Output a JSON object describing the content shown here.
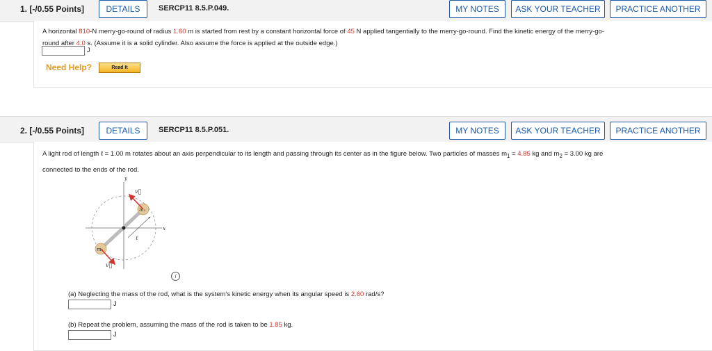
{
  "q1": {
    "number": "1.  [-/0.55 Points]",
    "details": "DETAILS",
    "code": "SERCP11 8.5.P.049.",
    "my_notes": "MY NOTES",
    "ask_teacher": "ASK YOUR TEACHER",
    "practice": "PRACTICE ANOTHER",
    "text1_a": "A horizontal ",
    "mass": "810",
    "text1_b": "-N merry-go-round of radius ",
    "radius": "1.60",
    "text1_c": " m is started from rest by a constant horizontal force of ",
    "force": "45",
    "text1_d": " N applied tangentially to the merry-go-round. Find the kinetic energy of the merry-go-",
    "text2_a": "round after ",
    "time": "4.0",
    "text2_b": " s. (Assume it is a solid cylinder. Also assume the force is applied at the outside edge.)",
    "unit": "J",
    "need_help": "Need Help?",
    "read_it": "Read It"
  },
  "q2": {
    "number": "2.  [-/0.55 Points]",
    "details": "DETAILS",
    "code": "SERCP11 8.5.P.051.",
    "my_notes": "MY NOTES",
    "ask_teacher": "ASK YOUR TEACHER",
    "practice": "PRACTICE ANOTHER",
    "text1_a": "A light rod of length ℓ = 1.00 m rotates about an axis perpendicular to its length and passing through its center as in the figure below. Two particles of masses m",
    "sub1": "1",
    "text1_b": " = ",
    "m1": "4.85",
    "text1_c": " kg and m",
    "sub2": "2",
    "text1_d": " = 3.00 kg are",
    "text2": "connected to the ends of the rod.",
    "figure": {
      "y_label": "y",
      "x_label": "x",
      "v_top": "v⃗",
      "v_bottom": "v⃗",
      "m2_label": "m₂",
      "m1_label": "m₁",
      "l_label": "ℓ"
    },
    "info_icon": "i",
    "part_a_a": "(a) Neglecting the mass of the rod, what is the system's kinetic energy when its angular speed is ",
    "omega": "2.60",
    "part_a_b": " rad/s?",
    "unit_a": "J",
    "part_b_a": "(b) Repeat the problem, assuming the mass of the rod is taken to be ",
    "rod_mass": "1.85",
    "part_b_b": " kg.",
    "unit_b": "J"
  },
  "colors": {
    "accent": "#1a5aa6",
    "highlight": "#d4342c",
    "help": "#e39a1b"
  }
}
